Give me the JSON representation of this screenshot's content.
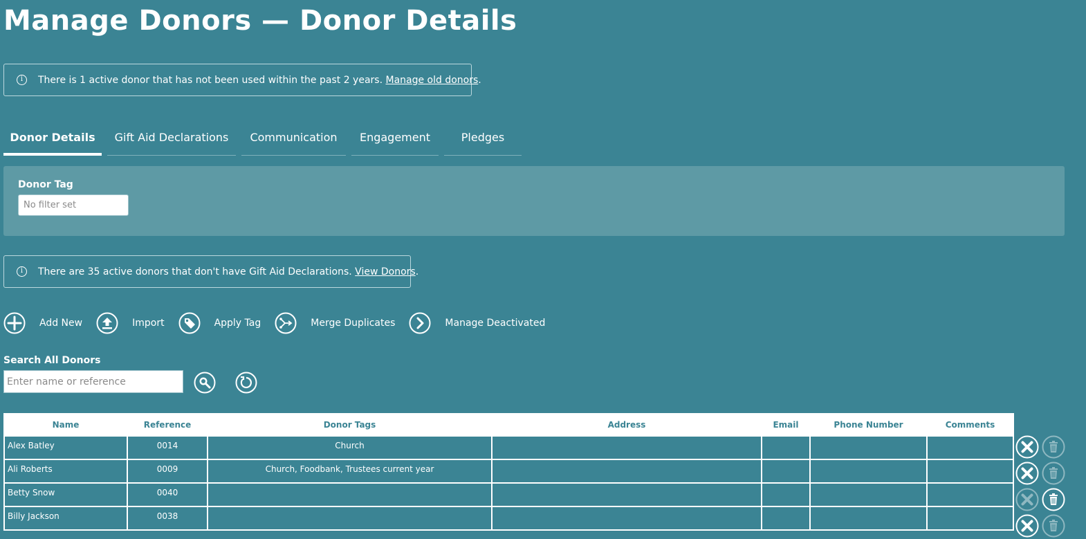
{
  "page_title": "Manage Donors — Donor Details",
  "notices": {
    "old_donors": {
      "text": "There is 1 active donor that has not been used within the past 2 years.",
      "link": "Manage old donors",
      "suffix": "."
    },
    "gift_aid": {
      "text": "There are 35 active donors that don't have Gift Aid Declarations.",
      "link": "View Donors",
      "suffix": "."
    }
  },
  "tabs": [
    {
      "label": "Donor Details",
      "active": true
    },
    {
      "label": "Gift Aid Declarations",
      "active": false
    },
    {
      "label": "Communication",
      "active": false
    },
    {
      "label": "Engagement",
      "active": false
    },
    {
      "label": "Pledges",
      "active": false
    }
  ],
  "filter": {
    "label": "Donor Tag",
    "placeholder": "No filter set"
  },
  "actions": [
    {
      "label": "Add New",
      "icon": "plus-icon"
    },
    {
      "label": "Import",
      "icon": "upload-icon"
    },
    {
      "label": "Apply Tag",
      "icon": "tag-icon"
    },
    {
      "label": "Merge Duplicates",
      "icon": "merge-icon"
    },
    {
      "label": "Manage Deactivated",
      "icon": "chevron-right-icon"
    }
  ],
  "search": {
    "label": "Search All Donors",
    "placeholder": "Enter name or reference"
  },
  "table": {
    "columns": [
      "Name",
      "Reference",
      "Donor Tags",
      "Address",
      "Email",
      "Phone Number",
      "Comments"
    ],
    "rows": [
      {
        "name": "Alex Batley",
        "reference": "0014",
        "tags": "Church",
        "address": "",
        "email": "",
        "phone": "",
        "comments": "",
        "deactivate_enabled": true,
        "delete_enabled": false
      },
      {
        "name": "Ali Roberts",
        "reference": "0009",
        "tags": "Church, Foodbank, Trustees current year",
        "address": "",
        "email": "",
        "phone": "",
        "comments": "",
        "deactivate_enabled": true,
        "delete_enabled": false
      },
      {
        "name": "Betty Snow",
        "reference": "0040",
        "tags": "",
        "address": "",
        "email": "",
        "phone": "",
        "comments": "",
        "deactivate_enabled": false,
        "delete_enabled": true
      },
      {
        "name": "Billy Jackson",
        "reference": "0038",
        "tags": "",
        "address": "",
        "email": "",
        "phone": "",
        "comments": "",
        "deactivate_enabled": true,
        "delete_enabled": false
      }
    ]
  },
  "colors": {
    "background": "#3b8494",
    "panel": "#5e9aa5",
    "header_text": "#3b8494",
    "disabled_icon": "#8fb8c1"
  }
}
